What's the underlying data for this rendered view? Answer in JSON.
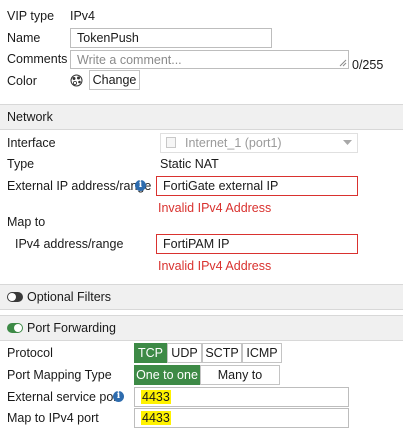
{
  "vip_type": {
    "label": "VIP type",
    "value": "IPv4"
  },
  "name": {
    "label": "Name",
    "value": "TokenPush"
  },
  "comments": {
    "label": "Comments",
    "placeholder": "Write a comment...",
    "counter": "0/255"
  },
  "color": {
    "label": "Color",
    "button": "Change",
    "icon": "palette-icon"
  },
  "network": {
    "title": "Network",
    "interface": {
      "label": "Interface",
      "value": "Internet_1 (port1)"
    },
    "type": {
      "label": "Type",
      "value": "Static NAT"
    },
    "external_ip": {
      "label": "External IP address/range",
      "value": "FortiGate external IP",
      "error": "Invalid IPv4 Address"
    },
    "map_to": {
      "label": "Map to"
    },
    "ipv4_range": {
      "label": "IPv4 address/range",
      "value": "FortiPAM IP",
      "error": "Invalid IPv4 Address"
    }
  },
  "optional_filters": {
    "title": "Optional Filters",
    "enabled": false
  },
  "port_forwarding": {
    "title": "Port Forwarding",
    "enabled": true,
    "protocol": {
      "label": "Protocol",
      "options": [
        "TCP",
        "UDP",
        "SCTP",
        "ICMP"
      ],
      "selected": "TCP"
    },
    "port_mapping_type": {
      "label": "Port Mapping Type",
      "options": [
        "One to one",
        "Many to many"
      ],
      "selected": "One to one"
    },
    "external_service_port": {
      "label": "External service port",
      "value": "4433"
    },
    "map_to_ipv4_port": {
      "label": "Map to IPv4 port",
      "value": "4433"
    }
  },
  "colors": {
    "accent": "#3d8a46",
    "error": "#d9322f",
    "highlight": "#fff200",
    "info": "#2e6cae"
  }
}
